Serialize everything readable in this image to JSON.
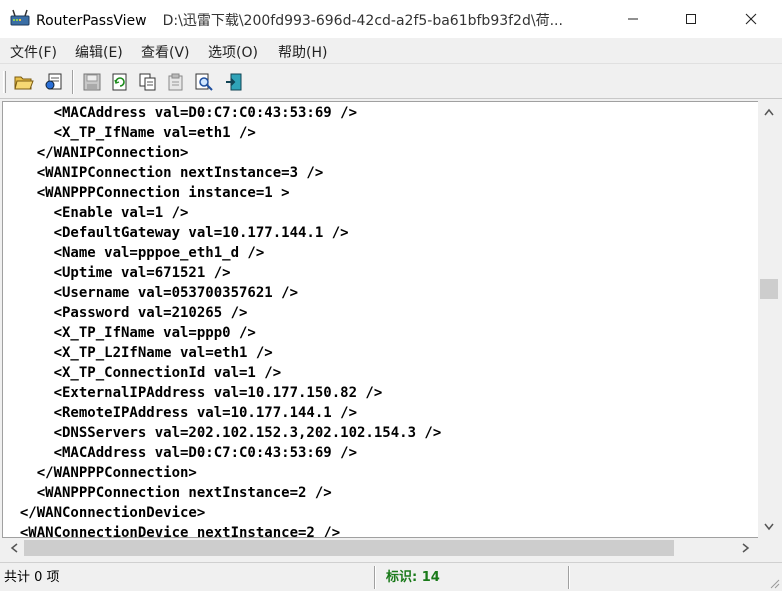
{
  "window": {
    "app_name": "RouterPassView",
    "path": "D:\\迅雷下载\\200fd993-696d-42cd-a2f5-ba61bfb93f2d\\荷...",
    "app_icon": "router-app-icon",
    "minimize_icon": "minimize-icon",
    "maximize_icon": "maximize-icon",
    "close_icon": "close-icon"
  },
  "menu": [
    {
      "label": "文件(F)"
    },
    {
      "label": "编辑(E)"
    },
    {
      "label": "查看(V)"
    },
    {
      "label": "选项(O)"
    },
    {
      "label": "帮助(H)"
    }
  ],
  "toolbar": {
    "buttons": [
      {
        "icon": "open-folder-icon"
      },
      {
        "icon": "open-file-icon"
      },
      {
        "icon": "save-icon"
      },
      {
        "icon": "refresh-icon"
      },
      {
        "icon": "copy-icon"
      },
      {
        "icon": "properties-icon"
      },
      {
        "icon": "find-icon"
      },
      {
        "icon": "exit-icon"
      }
    ]
  },
  "content": {
    "lines": [
      {
        "text": "      <MACAddress val=D0:C7:C0:43:53:69 />"
      },
      {
        "text": "      <X_TP_IfName val=eth1 />"
      },
      {
        "text": "    </WANIPConnection>"
      },
      {
        "text": "    <WANIPConnection nextInstance=3 />"
      },
      {
        "text": "    <WANPPPConnection instance=1 >"
      },
      {
        "text": "      <Enable val=1 />"
      },
      {
        "text": "      <DefaultGateway val=10.177.144.1 />"
      },
      {
        "text": "      <Name val=pppoe_eth1_d />"
      },
      {
        "text": "      <Uptime val=671521 />"
      },
      {
        "text": "      <Username val=053700357621 />"
      },
      {
        "text": "      <Password val=210265 />"
      },
      {
        "text": "      <X_TP_IfName val=ppp0 />"
      },
      {
        "text": "      <X_TP_L2IfName val=eth1 />"
      },
      {
        "text": "      <X_TP_ConnectionId val=1 />"
      },
      {
        "text": "      <ExternalIPAddress val=10.177.150.82 />"
      },
      {
        "text": "      <RemoteIPAddress val=10.177.144.1 />"
      },
      {
        "text": "      <DNSServers val=202.102.152.3,202.102.154.3 />"
      },
      {
        "text": "      <MACAddress val=D0:C7:C0:43:53:69 />"
      },
      {
        "text": "    </WANPPPConnection>"
      },
      {
        "text": "    <WANPPPConnection nextInstance=2 />"
      },
      {
        "text": "  </WANConnectionDevice>"
      },
      {
        "text": "  <WANConnectionDevice nextInstance=2 />"
      }
    ]
  },
  "scrollbars": {
    "up_icon": "scroll-up-icon",
    "down_icon": "scroll-down-icon",
    "left_icon": "scroll-left-icon",
    "right_icon": "scroll-right-icon",
    "vertical_position": 0.42
  },
  "status": {
    "count_text": "共计 0 项",
    "marker_text": "标识: 14"
  },
  "colors": {
    "status_marker": "#1a7a1a",
    "titlebar_bg": "#ffffff",
    "content_bg": "#ffffff"
  }
}
